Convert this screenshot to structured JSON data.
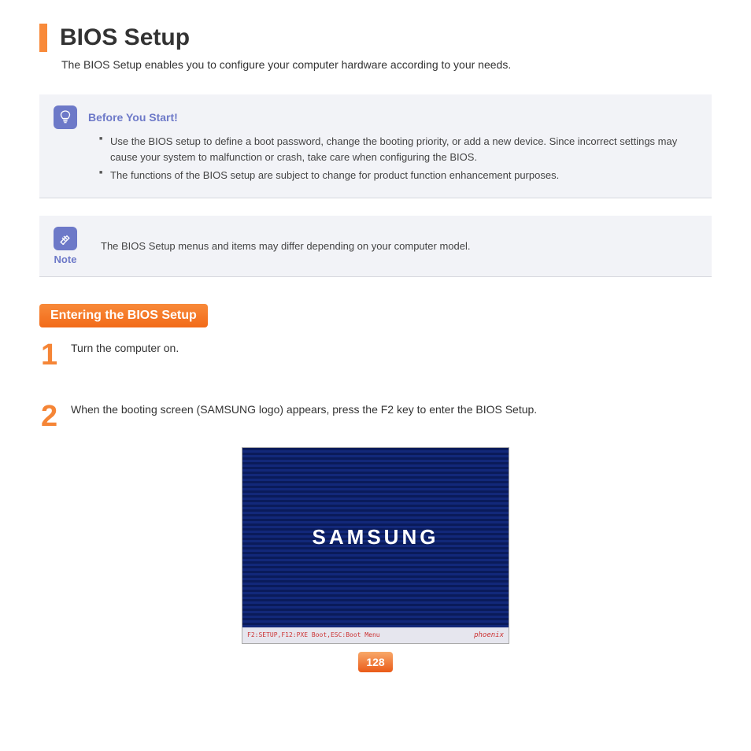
{
  "title": "BIOS Setup",
  "subtitle": "The BIOS Setup enables you to configure your computer hardware according to your needs.",
  "before_start": {
    "heading": "Before You Start!",
    "bullets": [
      "Use the BIOS setup to define a boot password, change the booting priority, or add a new device. Since incorrect settings may cause your system to malfunction or crash, take care when configuring the BIOS.",
      "The functions of the BIOS setup are subject to change for product function enhancement purposes."
    ]
  },
  "note": {
    "label": "Note",
    "text": "The BIOS Setup menus and items may differ depending on your computer model."
  },
  "section_heading": "Entering the BIOS Setup",
  "steps": [
    {
      "num": "1",
      "text": "Turn the computer on."
    },
    {
      "num": "2",
      "text": "When the booting screen (SAMSUNG logo) appears, press the F2 key to enter the BIOS Setup."
    }
  ],
  "boot_screen": {
    "logo": "SAMSUNG",
    "footer_left": "F2:SETUP,F12:PXE Boot,ESC:Boot Menu",
    "footer_right": "phoenix"
  },
  "page_number": "128"
}
